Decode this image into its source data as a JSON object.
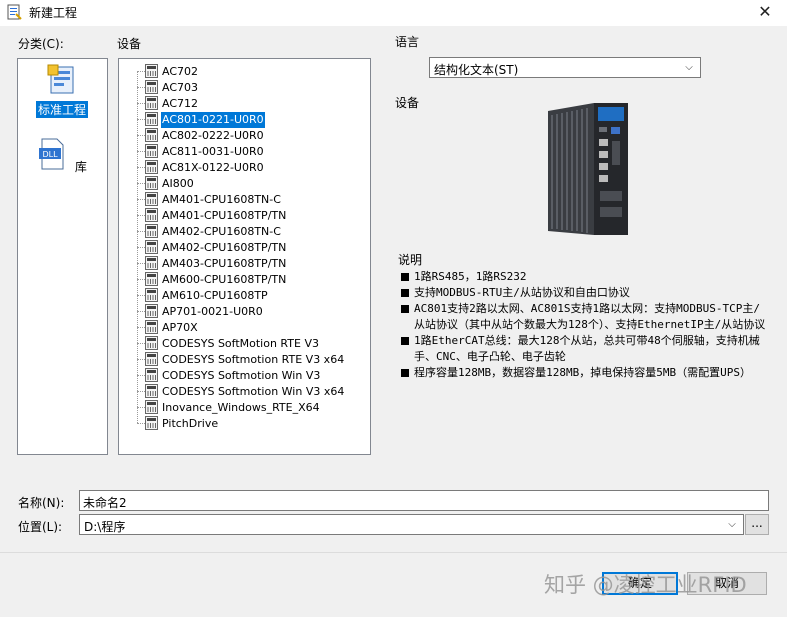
{
  "window": {
    "title": "新建工程",
    "close_glyph": "✕"
  },
  "categories": {
    "label": "分类(C):",
    "items": [
      {
        "label": "标准工程",
        "icon": "standard-project-icon",
        "selected": true
      },
      {
        "label": "库",
        "icon": "dll-library-icon",
        "icon_text": "DLL",
        "selected": false
      }
    ]
  },
  "devices": {
    "label": "设备",
    "items": [
      "AC702",
      "AC703",
      "AC712",
      "AC801-0221-U0R0",
      "AC802-0222-U0R0",
      "AC811-0031-U0R0",
      "AC81X-0122-U0R0",
      "AI800",
      "AM401-CPU1608TN-C",
      "AM401-CPU1608TP/TN",
      "AM402-CPU1608TN-C",
      "AM402-CPU1608TP/TN",
      "AM403-CPU1608TP/TN",
      "AM600-CPU1608TP/TN",
      "AM610-CPU1608TP",
      "AP701-0021-U0R0",
      "AP70X",
      "CODESYS SoftMotion RTE V3",
      "CODESYS Softmotion RTE V3 x64",
      "CODESYS Softmotion Win V3",
      "CODESYS Softmotion Win V3 x64",
      "Inovance_Windows_RTE_X64",
      "PitchDrive"
    ],
    "selected_index": 3
  },
  "language": {
    "label": "语言",
    "value": "结构化文本(ST)"
  },
  "device_preview": {
    "label": "设备"
  },
  "description": {
    "heading": "说明",
    "bullets": [
      "1路RS485，1路RS232",
      "支持MODBUS-RTU主/从站协议和自由口协议",
      "AC801支持2路以太网、AC801S支持1路以太网：支持MODBUS-TCP主/从站协议（其中从站个数最大为128个）、支持EthernetIP主/从站协议",
      "1路EtherCAT总线：最大128个从站，总共可带48个伺服轴，支持机械手、CNC、电子凸轮、电子齿轮",
      "程序容量128MB，数据容量128MB，掉电保持容量5MB（需配置UPS）"
    ]
  },
  "name_field": {
    "label": "名称(N):",
    "value": "未命名2"
  },
  "location_field": {
    "label": "位置(L):",
    "value": "D:\\程序",
    "browse_label": "..."
  },
  "buttons": {
    "ok_label": "确定",
    "cancel_label": "取消"
  },
  "watermark": "知乎 @凌控工业RFID"
}
